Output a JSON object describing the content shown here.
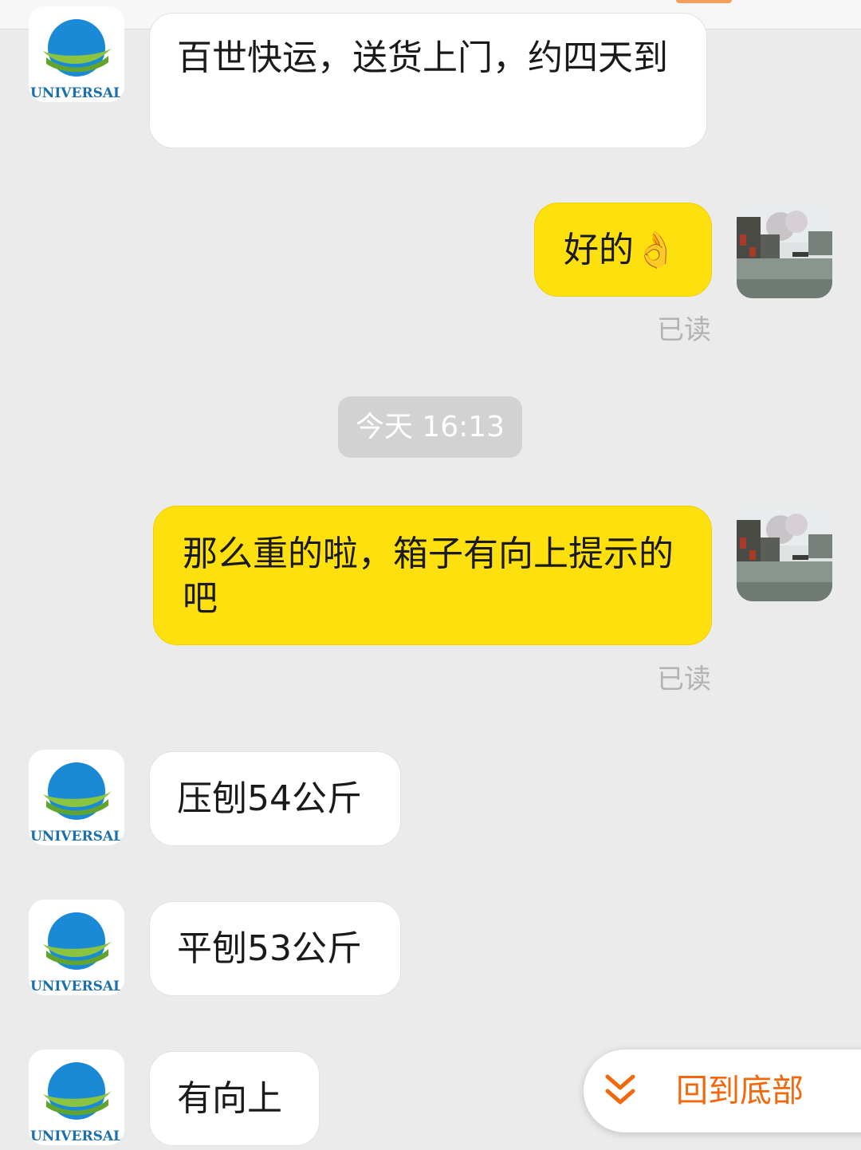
{
  "brand": {
    "accent": "#ffe00f",
    "link_orange": "#f2680c",
    "avatar_logo_text": "UNIVERSAL"
  },
  "messages": [
    {
      "side": "left",
      "sender": "shop",
      "text": "百世快运，送货上门，约四天到"
    },
    {
      "side": "right",
      "sender": "me",
      "text": "好的👌",
      "status": "已读"
    },
    {
      "type": "time",
      "text": "今天  16:13"
    },
    {
      "side": "right",
      "sender": "me",
      "text": "那么重的啦，箱子有向上提示的吧",
      "status": "已读"
    },
    {
      "side": "left",
      "sender": "shop",
      "text": "压刨54公斤"
    },
    {
      "side": "left",
      "sender": "shop",
      "text": "平刨53公斤"
    },
    {
      "side": "left",
      "sender": "shop",
      "text": "有向上"
    }
  ],
  "scroll_to_bottom": {
    "label": "回到底部",
    "icon": "double-chevron-down-icon"
  }
}
